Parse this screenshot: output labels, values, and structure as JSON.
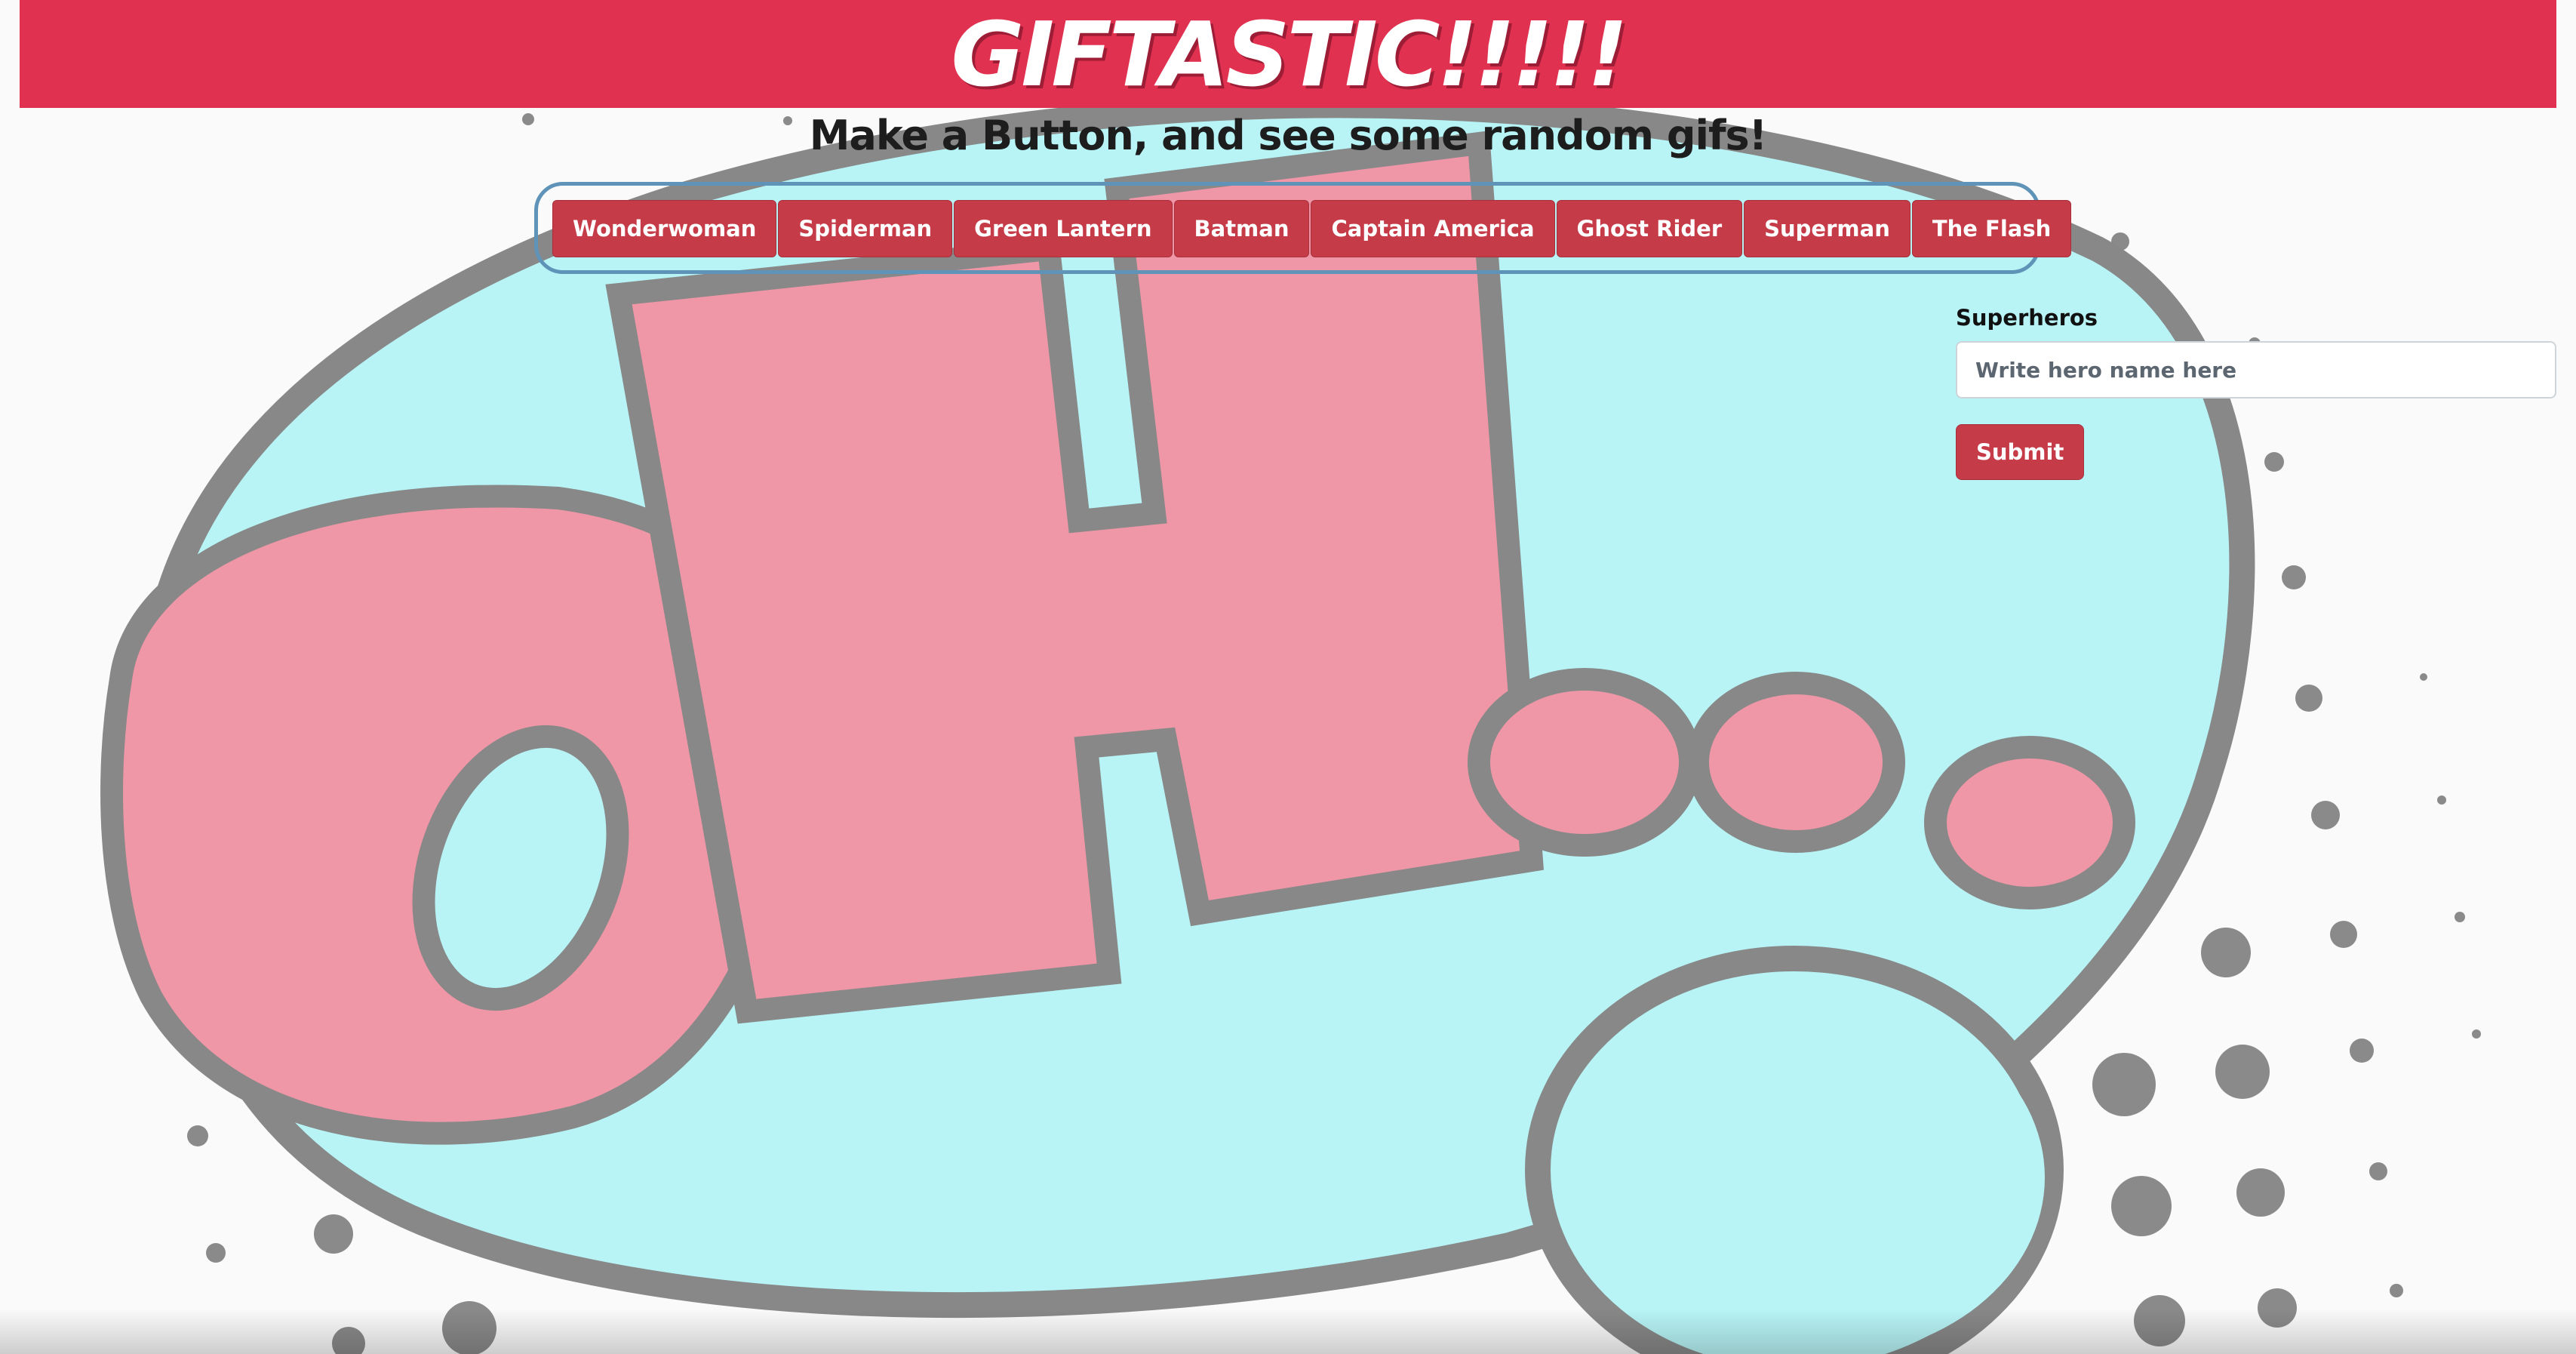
{
  "header": {
    "title": "GIFTASTIC!!!!!"
  },
  "subtitle": "Make a Button, and see some random gifs!",
  "buttons": [
    {
      "label": "Wonderwoman"
    },
    {
      "label": "Spiderman"
    },
    {
      "label": "Green Lantern"
    },
    {
      "label": "Batman"
    },
    {
      "label": "Captain America"
    },
    {
      "label": "Ghost Rider"
    },
    {
      "label": "Superman"
    },
    {
      "label": "The Flash"
    }
  ],
  "form": {
    "label": "Superheros",
    "input_value": "",
    "input_placeholder": "Write hero name here",
    "submit_label": "Submit"
  },
  "background": {
    "lettering": "OH!..."
  },
  "colors": {
    "header": "#e13150",
    "button": "#c53b48",
    "bubble": "#b8f4f6",
    "lettering": "#ef97a6",
    "outline": "#888888"
  }
}
